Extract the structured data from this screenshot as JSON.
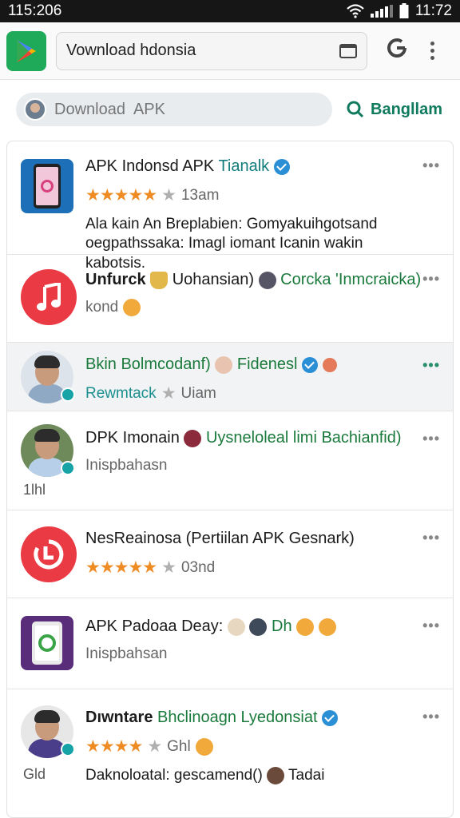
{
  "status_bar": {
    "left_time": "115:206",
    "right_time": "11:72"
  },
  "address_bar": {
    "url_text": "Vownload hdonsia"
  },
  "search": {
    "placeholder": "Download  APK",
    "action_label": "Bangllam"
  },
  "rows": [
    {
      "icon": "phone-app-icon",
      "title_main": "APK Indonsd APK",
      "title_accent": "Tianalk",
      "rating_stars": 4.5,
      "rating_text": "13am",
      "desc": "Ala kain An Breplabien: Gomyakuihgotsand oegpathssaka: Imagl iomant  Icanin wakin kabotsis."
    },
    {
      "icon": "music-note-icon",
      "title_main": "Unfurck",
      "title_mid": "Uohansian)",
      "title_accent": "Corcka 'Inmcraicka)",
      "sub": "kond"
    },
    {
      "icon": "avatar",
      "title_main": "Bkin Bolmcodanf)",
      "title_accent": "Fidenesl",
      "sub_main": "Rewmtack",
      "sub_rating": "Uiam"
    },
    {
      "icon": "avatar",
      "title_main": "DPK Imonain",
      "title_accent": "Uysneloleal limi Bachianfid)",
      "sub": "Inispbahasn",
      "thumb_label": "1lhl"
    },
    {
      "icon": "timer-app-icon",
      "title_main": "NesReainosa (Pertiilan APK Gesnark)",
      "rating_stars": 4.5,
      "rating_text": "03nd"
    },
    {
      "icon": "phone-app-icon",
      "title_main": "APK Padoaa Deay:",
      "title_accent": "Dh",
      "sub": "Inispbahsan"
    },
    {
      "icon": "avatar",
      "title_main": "Dıwntare",
      "title_accent": "Bhclinoagn Lyedonsiat",
      "rating_stars": 3.5,
      "rating_text": "Ghl",
      "desc": "Daknoloatal: gescamend()",
      "desc_end": "Tadai",
      "thumb_label": "Gld"
    }
  ],
  "colors": {
    "accent_green": "#1a7a3c",
    "star_orange": "#ef8b23",
    "verified_blue": "#2b8fd6",
    "play_green": "#1faa5a"
  },
  "icons": [
    "wifi-icon",
    "signal-icon",
    "battery-icon",
    "play-store-icon",
    "tabs-icon",
    "google-icon",
    "menu-kebab-icon",
    "search-icon",
    "more-icon"
  ]
}
